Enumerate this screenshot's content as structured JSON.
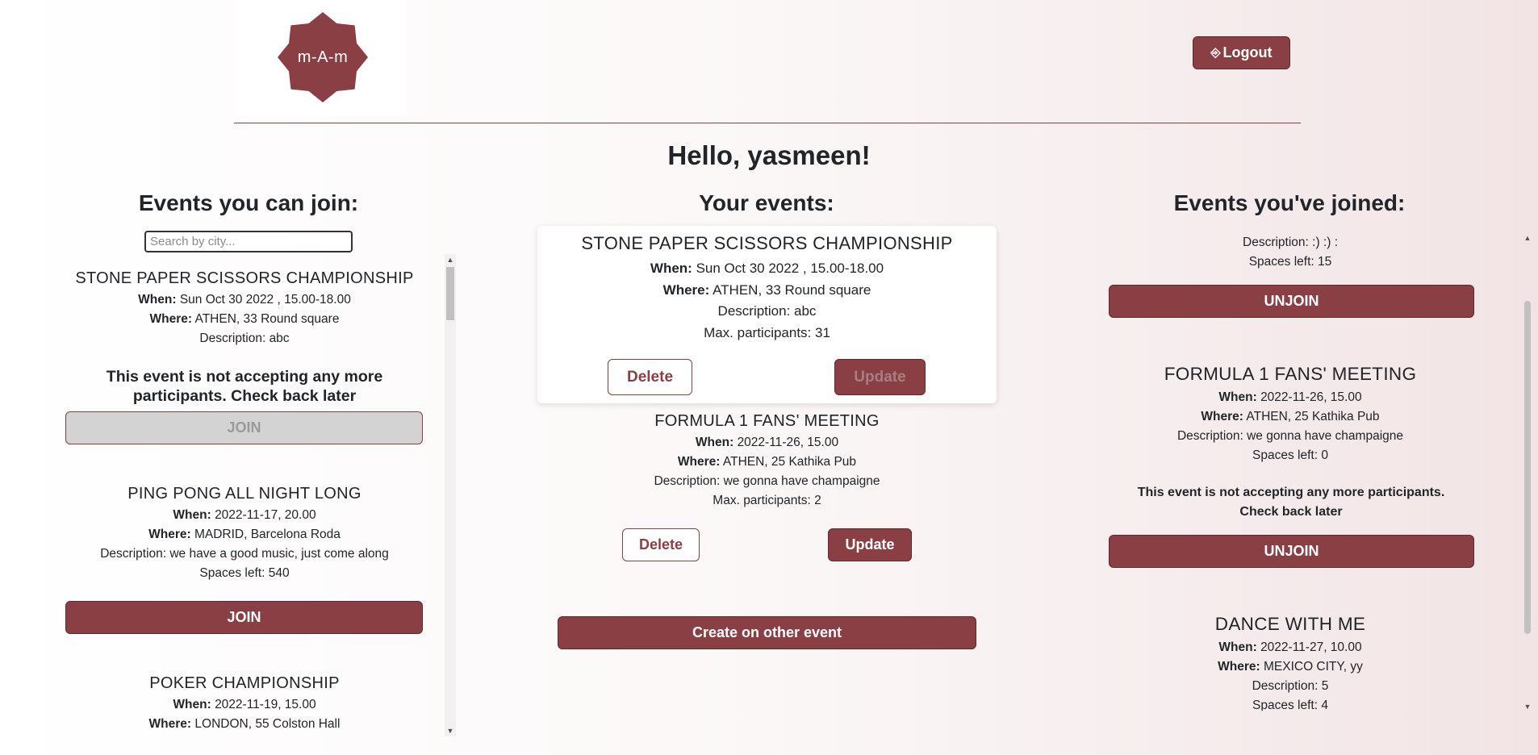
{
  "header": {
    "logo_text": "m-A-m",
    "logout_icon": "logout-icon",
    "logout_label": "Logout",
    "greeting": "Hello, yasmeen!"
  },
  "columns": {
    "join_title": "Events you can join:",
    "your_title": "Your events:",
    "joined_title": "Events you've joined:"
  },
  "search": {
    "placeholder": "Search by city..."
  },
  "labels": {
    "when": "When:",
    "where": "Where:"
  },
  "can_join": [
    {
      "name": "STONE PAPER SCISSORS CHAMPIONSHIP",
      "when": "Sun Oct 30 2022 , 15.00-18.00",
      "where": "ATHEN, 33 Round square",
      "description": "Description: abc",
      "notice": "This event is not accepting any more participants. Check back later",
      "button": "JOIN"
    },
    {
      "name": "PING PONG ALL NIGHT LONG",
      "when": "2022-11-17, 20.00",
      "where": "MADRID, Barcelona Roda",
      "description": "Description: we have a good music, just come along",
      "spaces": "Spaces left: 540",
      "button": "JOIN"
    },
    {
      "name": "POKER CHAMPIONSHIP",
      "when": "2022-11-19, 15.00",
      "where": "LONDON, 55 Colston Hall"
    }
  ],
  "your_events": [
    {
      "name": "STONE PAPER SCISSORS CHAMPIONSHIP",
      "when": "Sun Oct 30 2022 , 15.00-18.00",
      "where": "ATHEN, 33 Round square",
      "description": "Description: abc",
      "max": "Max. participants: 31",
      "delete": "Delete",
      "update": "Update"
    },
    {
      "name": "FORMULA 1 FANS' MEETING",
      "when": "2022-11-26, 15.00",
      "where": "ATHEN, 25 Kathika Pub",
      "description": "Description: we gonna have champaigne",
      "max": "Max. participants: 2",
      "delete": "Delete",
      "update": "Update"
    }
  ],
  "create_button": "Create on other event",
  "joined": [
    {
      "description": "Description: :) :) :",
      "spaces": "Spaces left: 15",
      "button": "UNJOIN"
    },
    {
      "name": "FORMULA 1 FANS' MEETING",
      "when": "2022-11-26, 15.00",
      "where": "ATHEN, 25 Kathika Pub",
      "description": "Description: we gonna have champaigne",
      "spaces": "Spaces left: 0",
      "notice": "This event is not accepting any more participants. Check back later",
      "button": "UNJOIN"
    },
    {
      "name": "DANCE WITH ME",
      "when": "2022-11-27, 10.00",
      "where": "MEXICO CITY, yy",
      "description": "Description: 5",
      "spaces": "Spaces left: 4"
    }
  ],
  "colors": {
    "accent": "#893f44",
    "disabled": "#d3d3d3"
  }
}
